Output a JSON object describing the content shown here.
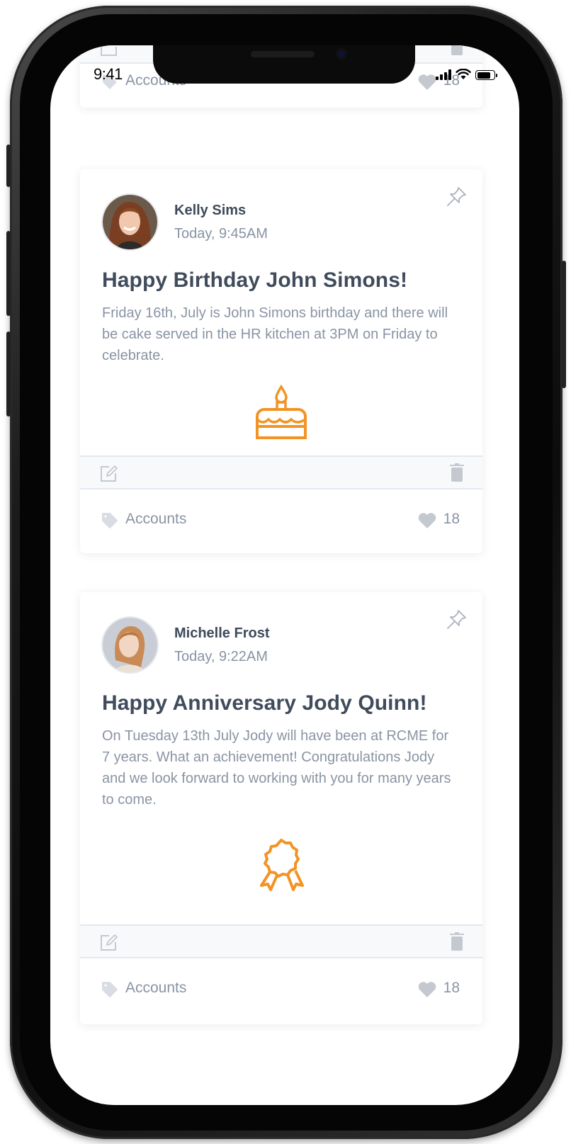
{
  "status_bar": {
    "time": "9:41",
    "signal_icon": "cellular-signal-icon",
    "wifi_icon": "wifi-icon",
    "battery_icon": "battery-icon"
  },
  "colors": {
    "accent": "#F39325",
    "text_dark": "#404B5B",
    "text_muted": "#8A94A4",
    "icon_gray": "#C4C9D0",
    "toolbar_bg": "#F8F9FB"
  },
  "posts": [
    {
      "partial": true,
      "tag": "Accounts",
      "likes": "18",
      "edit_icon": "edit-icon",
      "delete_icon": "trash-icon"
    },
    {
      "author": "Kelly Sims",
      "timestamp": "Today, 9:45AM",
      "title": "Happy Birthday John Simons!",
      "body": "Friday 16th, July is John Simons birthday and there will be cake served in the HR kitchen at 3PM on Friday to celebrate.",
      "icon": "birthday-cake-icon",
      "tag": "Accounts",
      "likes": "18",
      "pin_icon": "pin-icon"
    },
    {
      "author": "Michelle Frost",
      "timestamp": "Today, 9:22AM",
      "title": "Happy Anniversary Jody Quinn!",
      "body": "On Tuesday 13th July Jody will have been at RCME for 7 years. What an achievement! Congratulations Jody and we look forward to working with you for many years to come.",
      "icon": "award-ribbon-icon",
      "tag": "Accounts",
      "likes": "18",
      "pin_icon": "pin-icon"
    }
  ]
}
